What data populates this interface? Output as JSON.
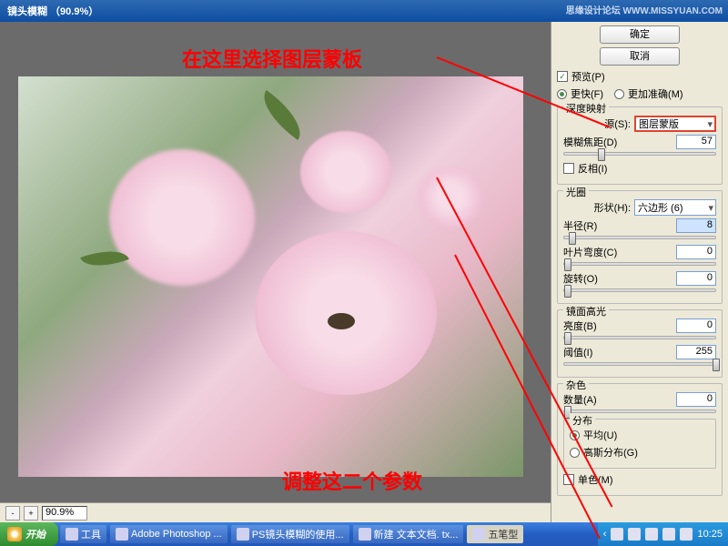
{
  "window": {
    "title": "镜头模糊 （90.9%）",
    "watermark": "思缘设计论坛  WWW.MISSYUAN.COM"
  },
  "annotations": {
    "top": "在这里选择图层蒙板",
    "bottom": "调整这二个参数"
  },
  "preview_bar": {
    "zoom": "90.9%"
  },
  "panel": {
    "ok": "确定",
    "cancel": "取消",
    "preview_cb": "预览(P)",
    "quick": "更快(F)",
    "accurate": "更加准确(M)",
    "depth_group": "深度映射",
    "source_label": "源(S):",
    "source_value": "图层蒙版",
    "focal_label": "模糊焦距(D)",
    "focal_value": "57",
    "invert_cb": "反相(I)",
    "iris_group": "光圈",
    "shape_label": "形状(H):",
    "shape_value": "六边形 (6)",
    "radius_label": "半径(R)",
    "radius_value": "8",
    "curvature_label": "叶片弯度(C)",
    "curvature_value": "0",
    "rotation_label": "旋转(O)",
    "rotation_value": "0",
    "specular_group": "镜面高光",
    "brightness_label": "亮度(B)",
    "brightness_value": "0",
    "threshold_label": "阈值(I)",
    "threshold_value": "255",
    "noise_group": "杂色",
    "mono_cb": "单色(M)",
    "amount_label": "数量(A)",
    "amount_value": "0",
    "dist_group": "分布",
    "uniform": "平均(U)",
    "gaussian": "高斯分布(G)"
  },
  "taskbar": {
    "start": "开始",
    "items": [
      "工具",
      "Adobe Photoshop ...",
      "PS镜头模糊的使用...",
      "新建 文本文档. tx..."
    ],
    "ime": "五笔型",
    "time": "10:25"
  }
}
